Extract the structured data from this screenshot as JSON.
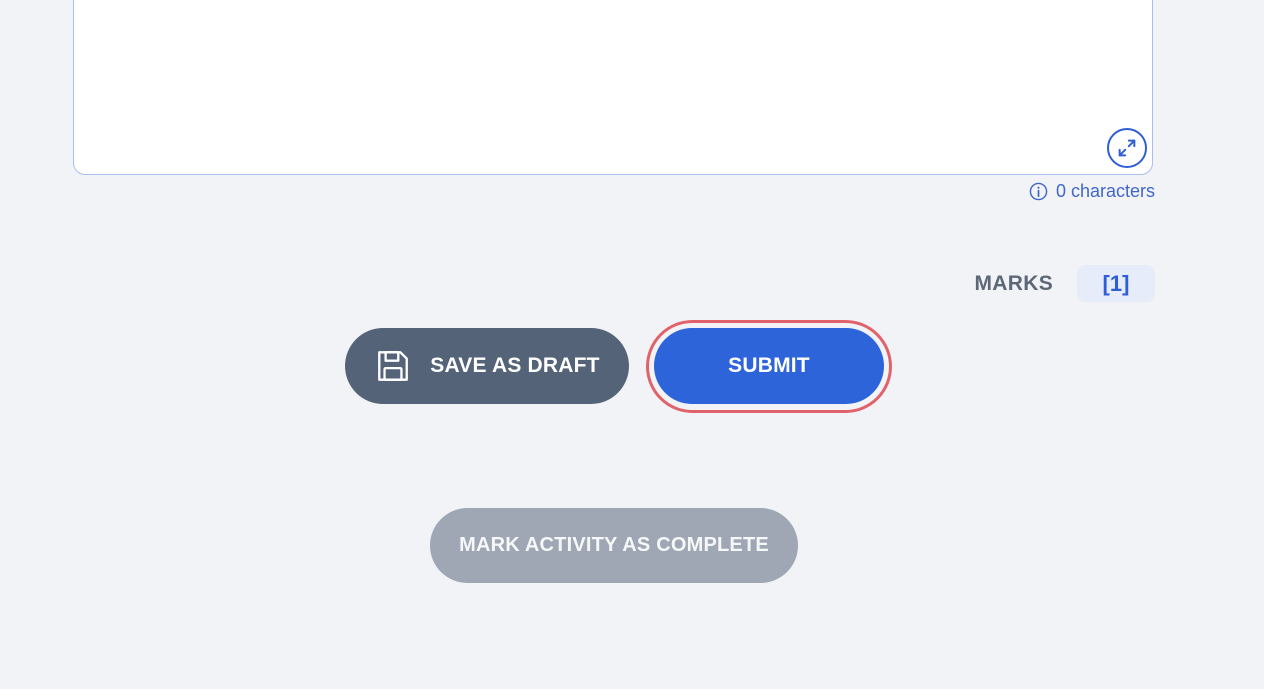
{
  "editor": {
    "value": "",
    "expand_icon": "expand-arrows-icon",
    "char_count_text": "0 characters",
    "info_icon": "info-icon"
  },
  "marks": {
    "label": "MARKS",
    "value": "[1]"
  },
  "actions": {
    "save_draft_label": "SAVE AS DRAFT",
    "save_icon": "floppy-disk-icon",
    "submit_label": "SUBMIT",
    "mark_complete_label": "MARK ACTIVITY AS COMPLETE"
  },
  "colors": {
    "background": "#f2f3f7",
    "primary": "#2d64d9",
    "draft": "#546378",
    "disabled": "#9ea7b3",
    "highlight": "#e0636b"
  }
}
